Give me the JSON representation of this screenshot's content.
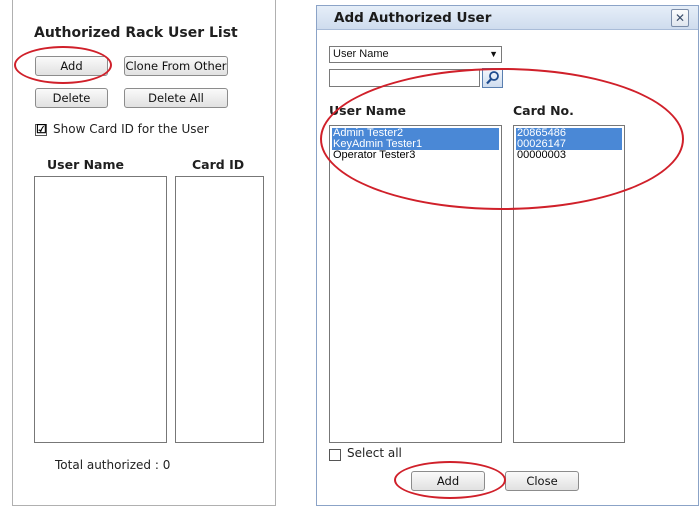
{
  "left_panel": {
    "title": "Authorized Rack User List",
    "buttons": {
      "add": "Add",
      "clone": "Clone From Other",
      "delete": "Delete",
      "delete_all": "Delete All"
    },
    "show_card_id": {
      "label": "Show Card ID for the User",
      "checked": true,
      "mark": "☑"
    },
    "columns": {
      "user_name": "User Name",
      "card_id": "Card ID"
    },
    "total_label": "Total authorized :",
    "total_value": "0"
  },
  "dialog": {
    "title": "Add Authorized User",
    "close_glyph": "✕",
    "filter_select": {
      "value": "User Name",
      "arrow": "▼"
    },
    "search_input": {
      "value": "",
      "placeholder": ""
    },
    "columns": {
      "user_name": "User Name",
      "card_no": "Card No."
    },
    "users": [
      {
        "name": "Admin Tester2",
        "card": "20865486",
        "selected": true
      },
      {
        "name": "KeyAdmin Tester1",
        "card": "00026147",
        "selected": true
      },
      {
        "name": "Operator Tester3",
        "card": "00000003",
        "selected": false
      }
    ],
    "select_all": {
      "label": "Select all",
      "checked": false
    },
    "buttons": {
      "add": "Add",
      "close": "Close"
    }
  },
  "colors": {
    "selection": "#4a88d6",
    "annotation": "#d0202a",
    "titlebar": "#cfdcee"
  }
}
